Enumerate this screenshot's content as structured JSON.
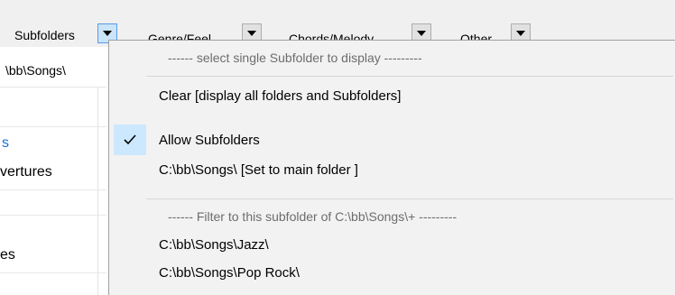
{
  "toolbar": {
    "subfolders_label": "Subfolders",
    "genre_label": "Genre/Feel",
    "chords_label": "Chords/Melody",
    "other_label": "Other"
  },
  "path_field": {
    "value": "\\bb\\Songs\\"
  },
  "list_fragments": [
    "s",
    "vertures",
    "es"
  ],
  "menu": {
    "header_single": "------ select single Subfolder to display ---------",
    "clear": "Clear [display all folders and Subfolders]",
    "allow_subfolders": "Allow Subfolders",
    "allow_subfolders_checked": true,
    "main_folder": "C:\\bb\\Songs\\    [Set to main folder ]",
    "header_filter": "------ Filter to this subfolder of C:\\bb\\Songs\\+ ---------",
    "jazz": "C:\\bb\\Songs\\Jazz\\",
    "pop_rock": "C:\\bb\\Songs\\Pop  Rock\\"
  },
  "icons": {
    "dropdown_arrow": "triangle-down-icon",
    "check": "check-icon"
  },
  "colors": {
    "highlight": "#cce8ff",
    "menu_bg": "#f2f2f2",
    "header_text": "#6d6d6d"
  }
}
